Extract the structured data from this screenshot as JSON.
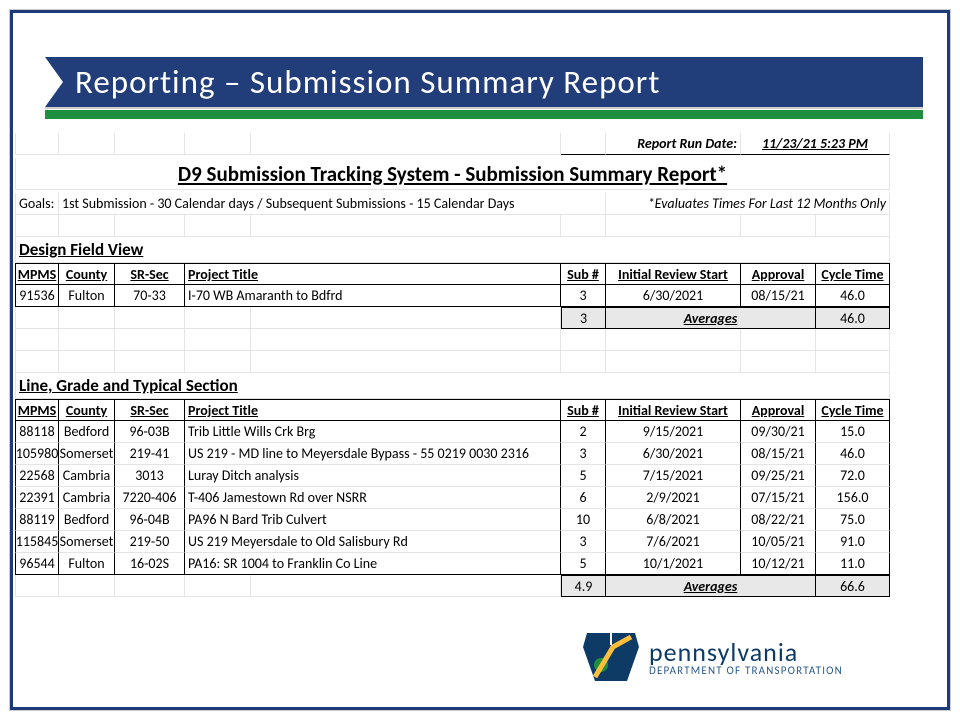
{
  "slide_title": "Reporting – Submission Summary Report",
  "run_date_label": "Report Run Date:",
  "run_date_value": "11/23/21 5:23 PM",
  "report_title": "D9 Submission Tracking System - Submission Summary Report*",
  "goals_label": "Goals:",
  "goals_text": "1st Submission - 30 Calendar days  /  Subsequent Submissions - 15 Calendar Days",
  "goals_note": "*Evaluates Times For Last 12 Months Only",
  "columns": {
    "mpms": "MPMS",
    "county": "County",
    "srsec": "SR-Sec",
    "title": "Project Title",
    "sub": "Sub #",
    "irs": "Initial Review Start",
    "approval": "Approval",
    "cycle": "Cycle Time"
  },
  "averages_label": "Averages",
  "section1": {
    "name": "Design Field View",
    "rows": [
      {
        "mpms": "91536",
        "county": "Fulton",
        "srsec": "70-33",
        "title": "I-70 WB Amaranth to Bdfrd",
        "sub": "3",
        "irs": "6/30/2021",
        "approval": "08/15/21",
        "cycle": "46.0"
      }
    ],
    "avg_sub": "3",
    "avg_cycle": "46.0"
  },
  "section2": {
    "name": "Line, Grade and Typical Section",
    "rows": [
      {
        "mpms": "88118",
        "county": "Bedford",
        "srsec": "96-03B",
        "title": "Trib Little Wills Crk Brg",
        "sub": "2",
        "irs": "9/15/2021",
        "approval": "09/30/21",
        "cycle": "15.0"
      },
      {
        "mpms": "105980",
        "county": "Somerset",
        "srsec": "219-41",
        "title": "US 219 - MD line to Meyersdale Bypass - 55 0219 0030 2316",
        "sub": "3",
        "irs": "6/30/2021",
        "approval": "08/15/21",
        "cycle": "46.0"
      },
      {
        "mpms": "22568",
        "county": "Cambria",
        "srsec": "3013",
        "title": "Luray Ditch analysis",
        "sub": "5",
        "irs": "7/15/2021",
        "approval": "09/25/21",
        "cycle": "72.0"
      },
      {
        "mpms": "22391",
        "county": "Cambria",
        "srsec": "7220-406",
        "title": "T-406 Jamestown Rd over NSRR",
        "sub": "6",
        "irs": "2/9/2021",
        "approval": "07/15/21",
        "cycle": "156.0"
      },
      {
        "mpms": "88119",
        "county": "Bedford",
        "srsec": "96-04B",
        "title": "PA96 N Bard Trib Culvert",
        "sub": "10",
        "irs": "6/8/2021",
        "approval": "08/22/21",
        "cycle": "75.0"
      },
      {
        "mpms": "115845",
        "county": "Somerset",
        "srsec": "219-50",
        "title": "US 219 Meyersdale to Old Salisbury Rd",
        "sub": "3",
        "irs": "7/6/2021",
        "approval": "10/05/21",
        "cycle": "91.0"
      },
      {
        "mpms": "96544",
        "county": "Fulton",
        "srsec": "16-02S",
        "title": "PA16: SR 1004 to Franklin Co Line",
        "sub": "5",
        "irs": "10/1/2021",
        "approval": "10/12/21",
        "cycle": "11.0"
      }
    ],
    "avg_sub": "4.9",
    "avg_cycle": "66.6"
  },
  "logo": {
    "state": "pennsylvania",
    "dept": "DEPARTMENT OF TRANSPORTATION"
  }
}
